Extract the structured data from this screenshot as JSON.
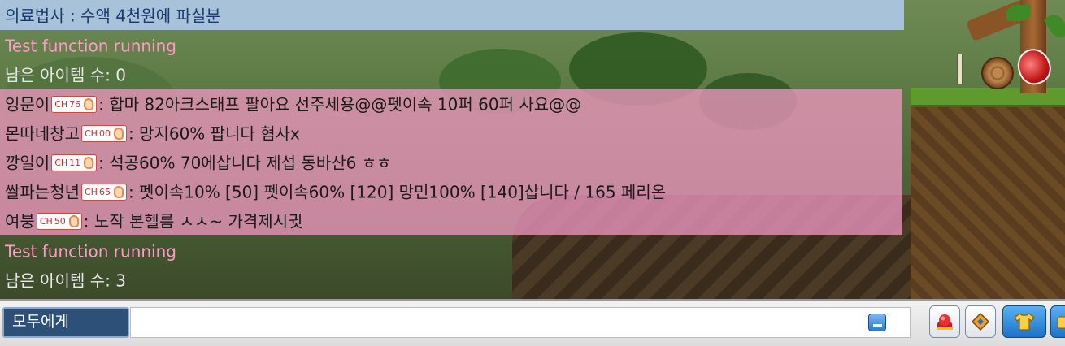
{
  "chat": {
    "header": "의료법사 : 수액 4천원에 파실분",
    "lines": [
      {
        "text": "Test function running"
      },
      {
        "text": "남은 아이템 수: 0"
      },
      {
        "name": "잉문이",
        "ch": "76",
        "msg": ": 합마 82아크스태프 팔아요 선주세용@@펫이속 10퍼 60퍼 사요@@"
      },
      {
        "name": "몬따네창고",
        "ch": "00",
        "msg": ": 망지60% 팝니다 혐사x"
      },
      {
        "name": "깡일이",
        "ch": "11",
        "msg": ": 석공60% 70에삽니다 제섭 동바산6 ㅎㅎ"
      },
      {
        "name": "쌀파는청년",
        "ch": "65",
        "msg": ": 펫이속10% [50] 펫이속60% [120] 망민100% [140]삽니다 / 165 페리온"
      },
      {
        "name": "여붕",
        "ch": "50",
        "msg": ": 노작 본헬름 ㅅㅅ~ 가격제시귓"
      },
      {
        "text": "Test function running"
      },
      {
        "text": "남은 아이템 수: 3"
      }
    ],
    "ch_prefix": "CH"
  },
  "input_bar": {
    "target_label": "모두에게",
    "input_value": "",
    "icons": [
      "minimize-icon",
      "megaphone-icon",
      "item-link-icon",
      "shirt-icon",
      "more-icon"
    ]
  },
  "colors": {
    "header_bg": "#a8c2da",
    "system_text": "#ff9ac8",
    "megaphone_bg": "#ec96be",
    "target_button": "#2c5078"
  }
}
